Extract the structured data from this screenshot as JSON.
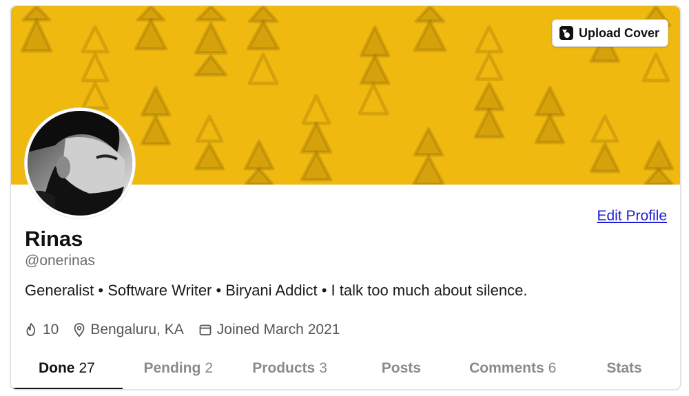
{
  "cover": {
    "upload_label": "Upload Cover",
    "color": "#f0b90f"
  },
  "profile": {
    "edit_label": "Edit Profile",
    "name": "Rinas",
    "handle": "@onerinas",
    "bio": "Generalist • Software Writer • Biryani Addict • I talk too much about silence.",
    "streak": "10",
    "location": "Bengaluru, KA",
    "joined": "Joined March 2021"
  },
  "tabs": [
    {
      "label": "Done",
      "count": "27"
    },
    {
      "label": "Pending",
      "count": "2"
    },
    {
      "label": "Products",
      "count": "3"
    },
    {
      "label": "Posts",
      "count": ""
    },
    {
      "label": "Comments",
      "count": "6"
    },
    {
      "label": "Stats",
      "count": ""
    }
  ]
}
